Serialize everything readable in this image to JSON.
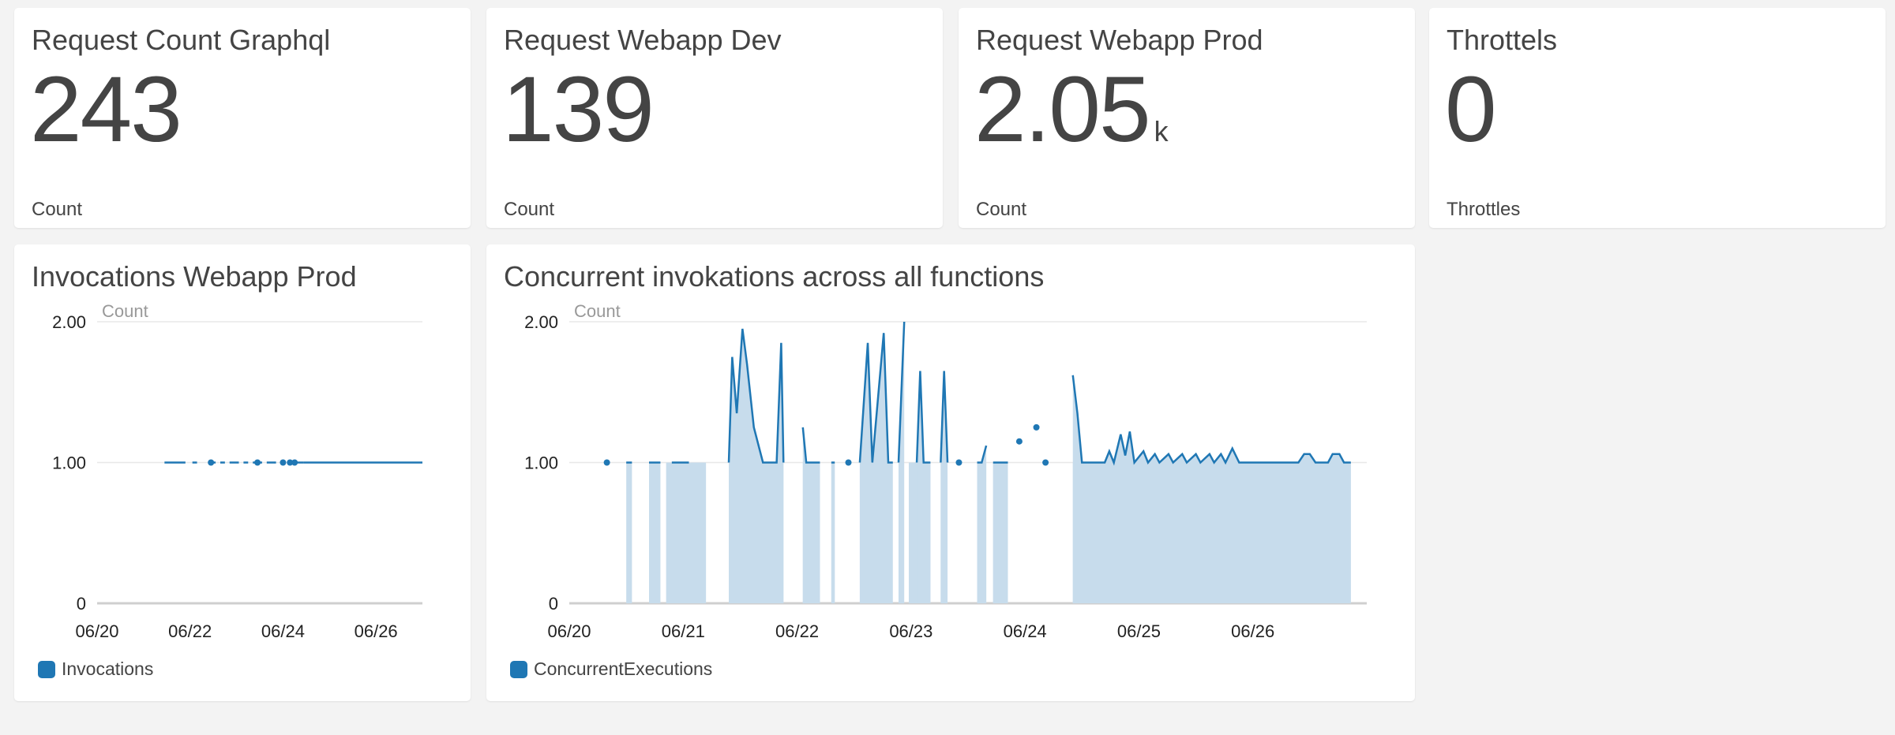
{
  "colors": {
    "series": "#1f77b4",
    "fill": "#c7dcec",
    "grid": "#e8e8e8",
    "axis": "#cfcfcf"
  },
  "widgets": [
    {
      "title": "Request Count Graphql",
      "value": "243",
      "unit": "",
      "label": "Count"
    },
    {
      "title": "Request Webapp Dev",
      "value": "139",
      "unit": "",
      "label": "Count"
    },
    {
      "title": "Request Webapp Prod",
      "value": "2.05",
      "unit": "k",
      "label": "Count"
    },
    {
      "title": "Throttels",
      "value": "0",
      "unit": "",
      "label": "Throttles"
    }
  ],
  "charts": [
    {
      "title": "Invocations Webapp Prod",
      "legend": "Invocations"
    },
    {
      "title": "Concurrent invokations across all functions",
      "legend": "ConcurrentExecutions"
    }
  ],
  "chart_data": [
    {
      "type": "line",
      "title": "Invocations Webapp Prod",
      "ylabel": "Count",
      "ylim": [
        0,
        2
      ],
      "yticks": [
        "2.00",
        "1.00",
        "0"
      ],
      "xticks": [
        "06/20",
        "06/22",
        "06/24",
        "06/26"
      ],
      "xlim": [
        0,
        7
      ],
      "series": [
        {
          "name": "Invocations",
          "x": [
            1.45,
            1.9,
            2.05,
            2.4,
            2.55,
            2.65,
            2.8,
            3.3,
            3.35,
            3.45,
            3.6,
            4.15,
            4.2,
            4.3,
            4.35,
            4.4,
            7.0
          ],
          "y": [
            1,
            1,
            1,
            1,
            1,
            1,
            1,
            1,
            1,
            1,
            1,
            1,
            1,
            1,
            1,
            1,
            1
          ],
          "segments": [
            [
              1.45,
              1.9
            ],
            [
              2.05,
              2.15
            ],
            [
              2.4,
              2.55
            ],
            [
              2.65,
              2.75
            ],
            [
              2.85,
              3.05
            ],
            [
              3.15,
              3.25
            ],
            [
              3.35,
              3.55
            ],
            [
              3.65,
              3.85
            ],
            [
              4.15,
              4.45
            ],
            [
              4.45,
              7.0
            ]
          ],
          "points": [
            [
              2.45,
              1
            ],
            [
              3.45,
              1
            ],
            [
              4.0,
              1
            ],
            [
              4.15,
              1
            ],
            [
              4.25,
              1
            ]
          ]
        }
      ]
    },
    {
      "type": "area",
      "title": "Concurrent invokations across all functions",
      "ylabel": "Count",
      "ylim": [
        0,
        2
      ],
      "yticks": [
        "2.00",
        "1.00",
        "0"
      ],
      "xticks": [
        "06/20",
        "06/21",
        "06/22",
        "06/23",
        "06/24",
        "06/25",
        "06/26"
      ],
      "xlim": [
        0,
        7
      ],
      "series": [
        {
          "name": "ConcurrentExecutions",
          "segments": [
            [
              [
                0.5,
                1
              ]
            ],
            [
              [
                0.5,
                1
              ],
              [
                0.55,
                1
              ]
            ],
            [
              [
                0.7,
                1
              ],
              [
                0.8,
                1
              ]
            ],
            [
              [
                0.9,
                1
              ],
              [
                1.05,
                1
              ]
            ],
            [
              [
                1.4,
                1
              ],
              [
                1.43,
                1.75
              ],
              [
                1.47,
                1.35
              ],
              [
                1.52,
                1.95
              ],
              [
                1.56,
                1.7
              ],
              [
                1.62,
                1.25
              ],
              [
                1.7,
                1.0
              ],
              [
                1.82,
                1.0
              ],
              [
                1.86,
                1.85
              ],
              [
                1.88,
                1.0
              ]
            ],
            [
              [
                2.05,
                1.25
              ],
              [
                2.08,
                1.0
              ],
              [
                2.2,
                1.0
              ]
            ],
            [
              [
                2.3,
                1.0
              ],
              [
                2.33,
                1.0
              ]
            ],
            [
              [
                2.55,
                1.0
              ],
              [
                2.62,
                1.85
              ],
              [
                2.66,
                1.0
              ],
              [
                2.76,
                1.92
              ],
              [
                2.8,
                1.0
              ],
              [
                2.84,
                1.0
              ]
            ],
            [
              [
                2.89,
                1.0
              ],
              [
                2.94,
                2.0
              ]
            ],
            [
              [
                3.05,
                1.0
              ],
              [
                3.08,
                1.65
              ],
              [
                3.11,
                1.0
              ],
              [
                3.17,
                1.0
              ]
            ],
            [
              [
                3.26,
                1.0
              ],
              [
                3.29,
                1.65
              ],
              [
                3.32,
                1.0
              ]
            ],
            [
              [
                3.58,
                1.0
              ],
              [
                3.62,
                1.0
              ],
              [
                3.66,
                1.12
              ]
            ],
            [
              [
                3.72,
                1.0
              ],
              [
                3.85,
                1.0
              ]
            ],
            [
              [
                4.42,
                1.62
              ],
              [
                4.46,
                1.35
              ],
              [
                4.5,
                1.0
              ],
              [
                4.7,
                1.0
              ],
              [
                4.74,
                1.08
              ],
              [
                4.78,
                1.0
              ],
              [
                4.84,
                1.2
              ],
              [
                4.88,
                1.05
              ],
              [
                4.92,
                1.22
              ],
              [
                4.96,
                1.0
              ],
              [
                5.04,
                1.08
              ],
              [
                5.08,
                1.0
              ],
              [
                5.14,
                1.06
              ],
              [
                5.18,
                1.0
              ],
              [
                5.26,
                1.06
              ],
              [
                5.3,
                1.0
              ],
              [
                5.38,
                1.06
              ],
              [
                5.42,
                1.0
              ],
              [
                5.5,
                1.06
              ],
              [
                5.54,
                1.0
              ],
              [
                5.62,
                1.06
              ],
              [
                5.66,
                1.0
              ],
              [
                5.72,
                1.06
              ],
              [
                5.76,
                1.0
              ],
              [
                5.82,
                1.1
              ],
              [
                5.88,
                1.0
              ],
              [
                6.0,
                1.0
              ],
              [
                6.4,
                1.0
              ],
              [
                6.45,
                1.06
              ],
              [
                6.5,
                1.06
              ],
              [
                6.55,
                1.0
              ],
              [
                6.66,
                1.0
              ],
              [
                6.7,
                1.06
              ],
              [
                6.76,
                1.06
              ],
              [
                6.8,
                1.0
              ],
              [
                6.86,
                1.0
              ]
            ]
          ],
          "points": [
            [
              0.33,
              1
            ],
            [
              2.45,
              1
            ],
            [
              3.42,
              1
            ],
            [
              3.95,
              1.15
            ],
            [
              4.1,
              1.25
            ],
            [
              4.18,
              1
            ]
          ],
          "fills": [
            [
              0.73,
              0.76
            ],
            [
              0.85,
              0.96
            ],
            [
              1.03,
              1.2
            ],
            [
              1.4,
              1.88
            ],
            [
              2.05,
              2.2
            ],
            [
              2.3,
              2.33
            ],
            [
              2.55,
              2.8
            ],
            [
              2.89,
              2.92
            ],
            [
              2.98,
              3.17
            ],
            [
              3.26,
              3.32
            ],
            [
              3.58,
              3.66
            ],
            [
              3.72,
              3.85
            ],
            [
              4.42,
              6.86
            ]
          ]
        }
      ]
    }
  ]
}
